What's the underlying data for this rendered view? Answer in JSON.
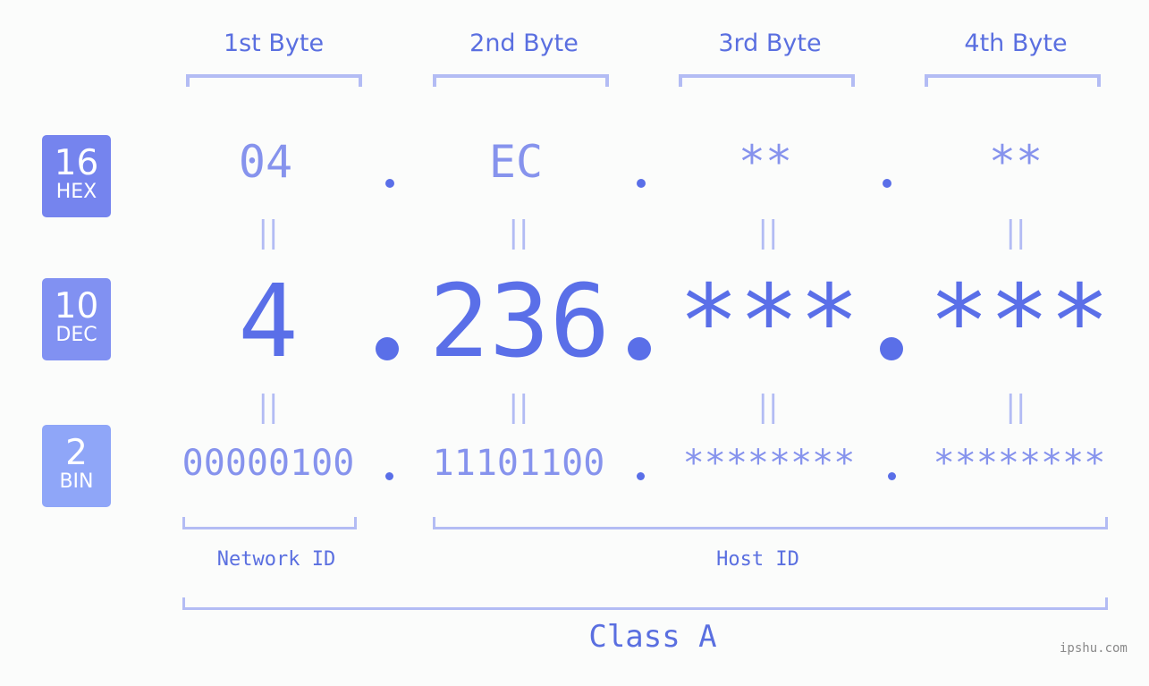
{
  "byte_headers": [
    "1st Byte",
    "2nd Byte",
    "3rd Byte",
    "4th Byte"
  ],
  "badges": {
    "hex": {
      "number": "16",
      "label": "HEX",
      "color": "#7584ee"
    },
    "dec": {
      "number": "10",
      "label": "DEC",
      "color": "#8191f2"
    },
    "bin": {
      "number": "2",
      "label": "BIN",
      "color": "#8fa6f8"
    }
  },
  "hex_values": [
    "04",
    "EC",
    "**",
    "**"
  ],
  "dec_values": [
    "4",
    "236",
    "***",
    "***"
  ],
  "bin_values": [
    "00000100",
    "11101100",
    "********",
    "********"
  ],
  "equals_symbol": "||",
  "network_label": "Network ID",
  "host_label": "Host ID",
  "class_label": "Class A",
  "watermark": "ipshu.com",
  "colors": {
    "accent": "#5a6fe8",
    "light_accent": "#8693ed",
    "bracket": "#b3bcf4",
    "background": "#fbfcfb"
  }
}
